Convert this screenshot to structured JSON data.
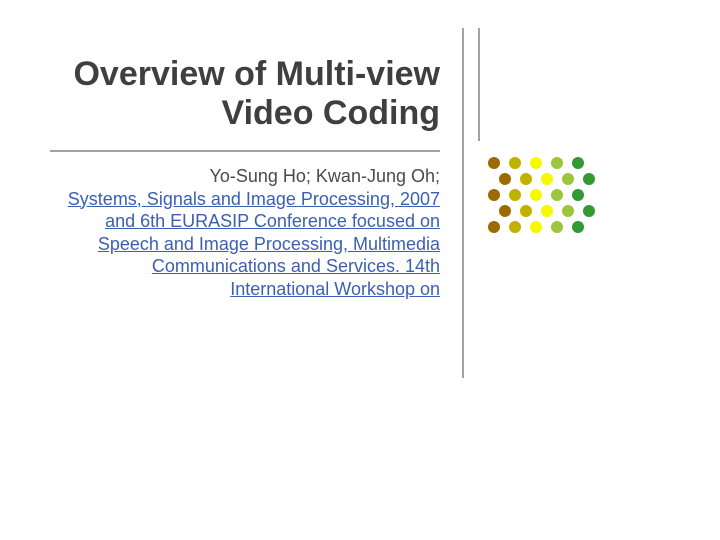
{
  "title": "Overview of Multi-view Video Coding",
  "authors": "Yo-Sung Ho; Kwan-Jung Oh;",
  "publication": "Systems, Signals and Image Processing, 2007 and 6th EURASIP Conference focused on Speech and Image Processing, Multimedia Communications and Services. 14th International Workshop on",
  "dot_colors": [
    "#9c6a00",
    "#c0b000",
    "#f8f800",
    "#9cc63c",
    "#339933"
  ]
}
